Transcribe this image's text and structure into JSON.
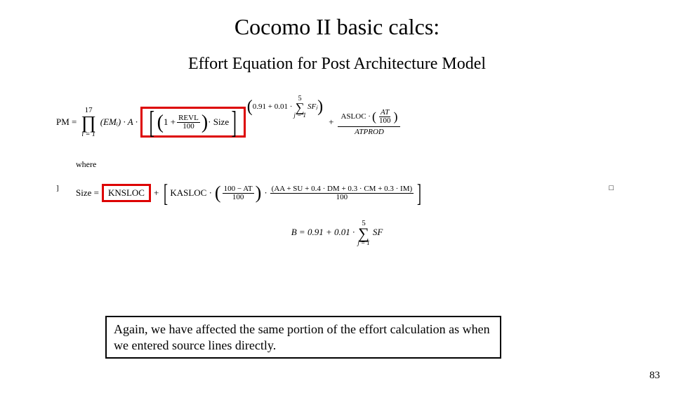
{
  "title": "Cocomo II basic calcs:",
  "subtitle": "Effort Equation for Post Architecture Model",
  "pm": {
    "lhs": "PM =",
    "prod_upper": "17",
    "prod_symbol": "∏",
    "prod_lower": "i = 1",
    "em": "(EMᵢ) · A ·",
    "revl_one_plus": "1 +",
    "revl_num": "REVL",
    "revl_den": "100",
    "size_label": "· Size",
    "exp_prefix": "0.91 + 0.01 ·",
    "exp_sum_top": "5",
    "exp_sum_sym": "∑",
    "exp_sum_bot": "j = 1",
    "exp_sf": "SFⱼ",
    "plus": "+",
    "asloc": "ASLOC ·",
    "at_num": "AT",
    "at_den": "100",
    "atprod": "ATPROD"
  },
  "where_label": "where",
  "size": {
    "lhs": "Size =",
    "knsloc": "KNSLOC",
    "plus1": "+",
    "kasloc": "KASLOC ·",
    "frac1_num": "100 − AT",
    "frac1_den": "100",
    "dot": "·",
    "frac2_num": "(AA + SU + 0.4 · DM + 0.3 · CM + 0.3 · IM)",
    "frac2_den": "100"
  },
  "b_eq": {
    "lhs": "B = 0.91 + 0.01 ·",
    "sum_top": "5",
    "sum_sym": "∑",
    "sum_bot": "j = 1",
    "sf": "SF"
  },
  "note": "Again, we have affected the same portion of the effort calculation as when we entered source lines directly.",
  "page_number": "83",
  "side_left": "]",
  "side_right": "□"
}
